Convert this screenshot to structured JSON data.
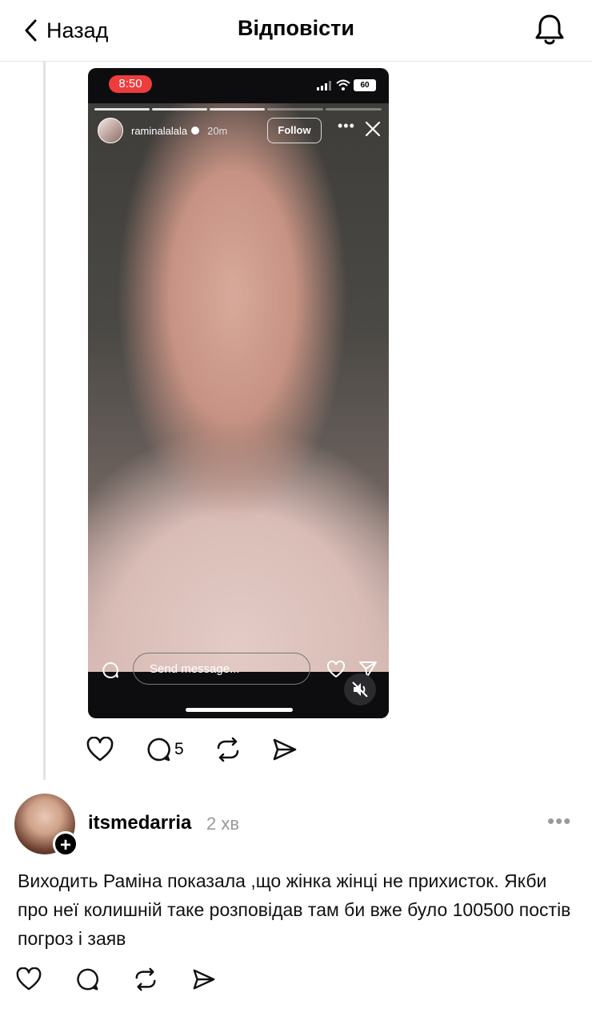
{
  "header": {
    "back_label": "Назад",
    "title": "Відповісти"
  },
  "story_screenshot": {
    "status_time": "8:50",
    "battery": "60",
    "username": "raminalalala",
    "age": "20m",
    "follow_label": "Follow",
    "message_placeholder": "Send message..."
  },
  "post_actions": {
    "reply_count": "5"
  },
  "reply": {
    "username": "itsmedarria",
    "timestamp": "2 хв",
    "text": "Виходить Раміна показала ,що жінка жінці не прихисток. Якби про неї колишній таке розповідав  там би вже було 100500 постів погроз і заяв"
  },
  "colors": {
    "accent_red": "#ef3c3c",
    "muted_gray": "#9a9a9a"
  }
}
